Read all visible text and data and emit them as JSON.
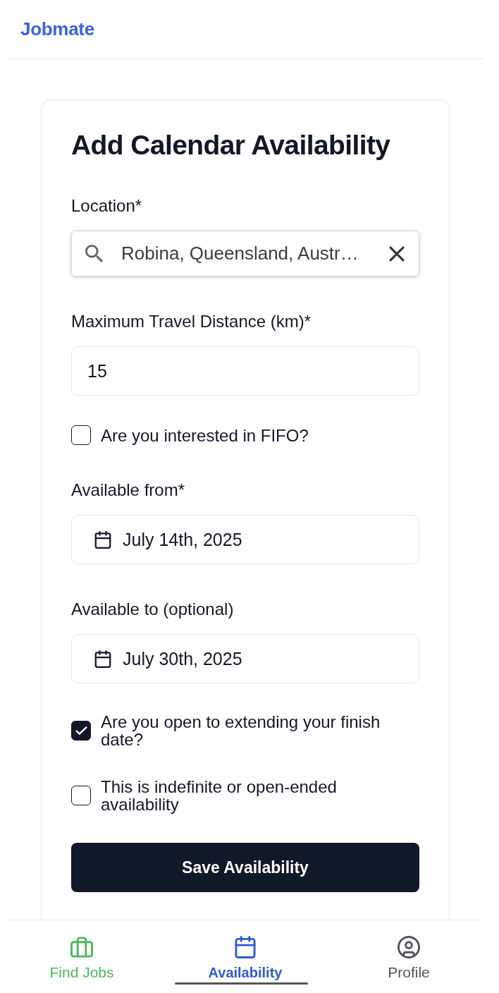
{
  "header": {
    "brand": "Jobmate"
  },
  "form": {
    "title": "Add Calendar Availability",
    "fields": [
      {
        "kind": "search",
        "label": "Location*",
        "value": "Robina, Queensland, Austr…"
      },
      {
        "kind": "text",
        "label": "Maximum Travel Distance (km)*",
        "value": "15"
      },
      {
        "kind": "checkbox",
        "label": "Are you interested in FIFO?",
        "checked": false
      },
      {
        "kind": "date",
        "label": "Available from*",
        "value": "July 14th, 2025"
      },
      {
        "kind": "date",
        "label": "Available to (optional)",
        "value": "July 30th, 2025"
      },
      {
        "kind": "checkbox",
        "label": "Are you open to extending your finish date?",
        "checked": true
      },
      {
        "kind": "checkbox",
        "label": "This is indefinite or open-ended availability",
        "checked": false
      }
    ],
    "submit": "Save Availability"
  },
  "bottom_nav": [
    {
      "label": "Find Jobs",
      "selected": false,
      "color": "#4cb85c"
    },
    {
      "label": "Availability",
      "selected": true,
      "color": "#2f5bd6"
    },
    {
      "label": "Profile",
      "selected": false,
      "color": "#4b5563"
    }
  ]
}
